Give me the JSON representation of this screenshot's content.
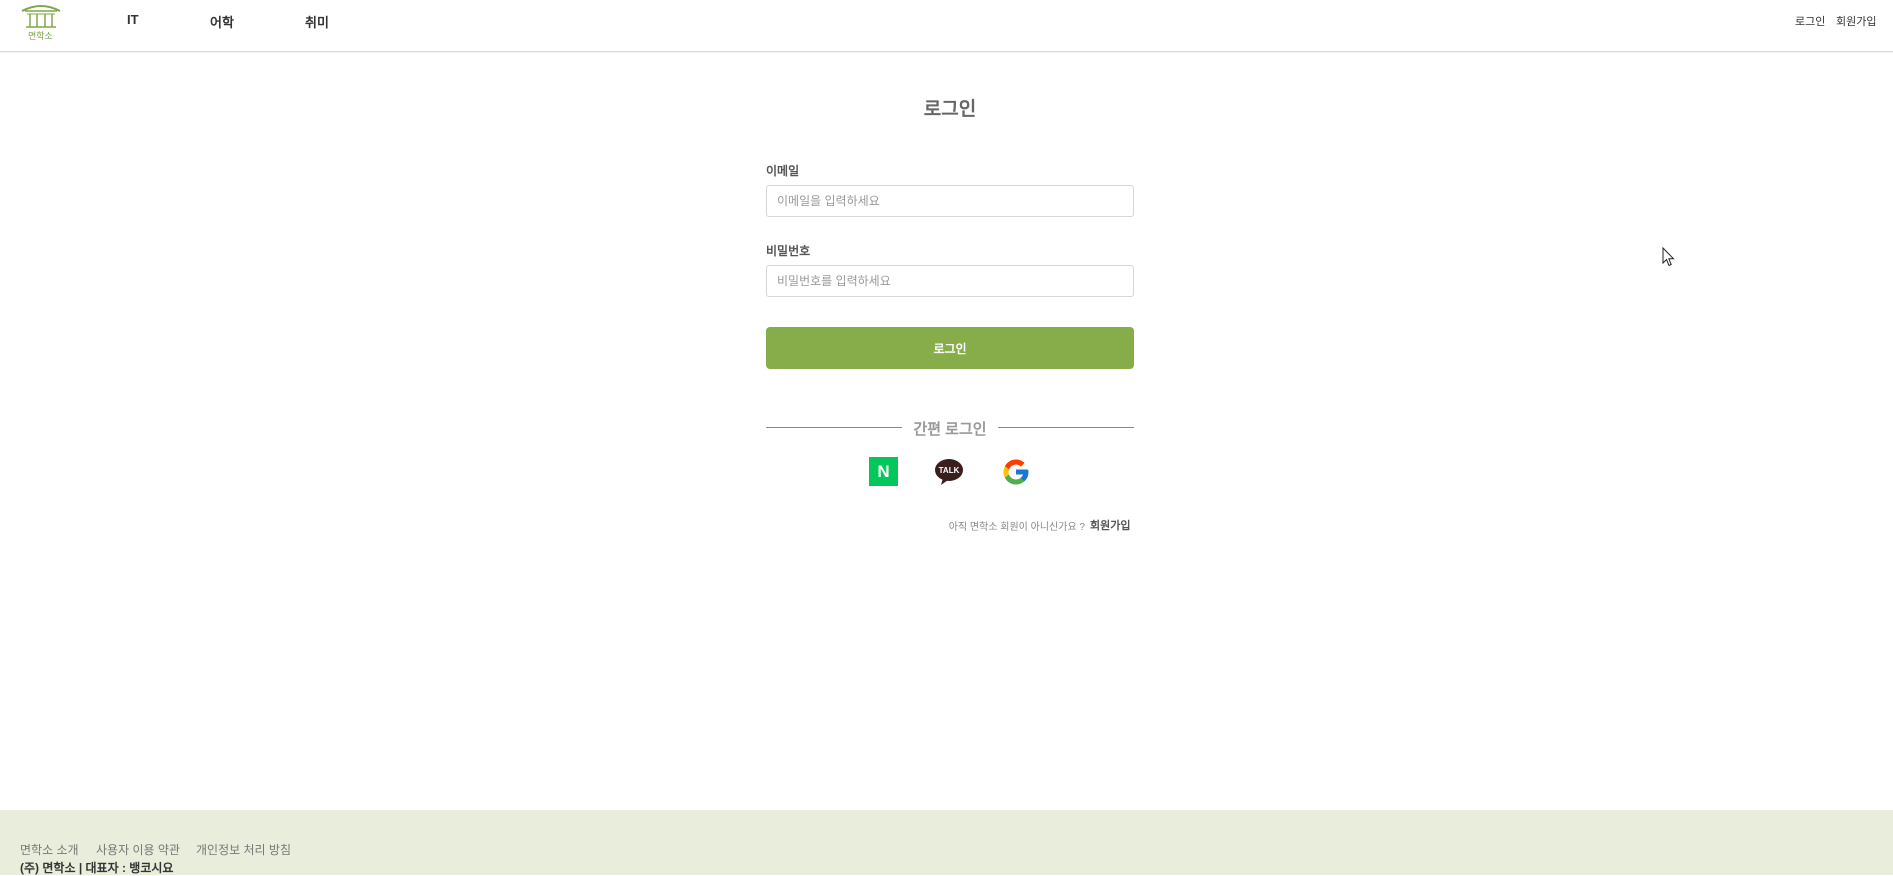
{
  "header": {
    "logo_text": "면학소",
    "nav": [
      {
        "label": "IT"
      },
      {
        "label": "어학"
      },
      {
        "label": "취미"
      }
    ],
    "auth": {
      "login_label": "로그인",
      "signup_label": "회원가입"
    }
  },
  "login_form": {
    "title": "로그인",
    "email_label": "이메일",
    "email_placeholder": "이메일을 입력하세요",
    "email_value": "",
    "password_label": "비밀번호",
    "password_placeholder": "비밀번호를 입력하세요",
    "password_value": "",
    "submit_label": "로그인",
    "divider_text": "간편 로그인",
    "social": {
      "naver_letter": "N",
      "kakao_text": "TALK"
    },
    "signup_prompt": "아직 면학소 회원이 아니신가요 ?",
    "signup_link": "회원가입"
  },
  "footer": {
    "links": [
      {
        "label": "면학소 소개"
      },
      {
        "label": "사용자 이용 약관"
      },
      {
        "label": "개인정보 처리 방침"
      }
    ],
    "company": "(주) 면학소 | 대표자 : 뱅코시요"
  },
  "colors": {
    "brand_green": "#86ad4a",
    "footer_bg": "#e8eedb",
    "naver_green": "#03c75a",
    "kakao_bubble": "#3a1d1d"
  }
}
